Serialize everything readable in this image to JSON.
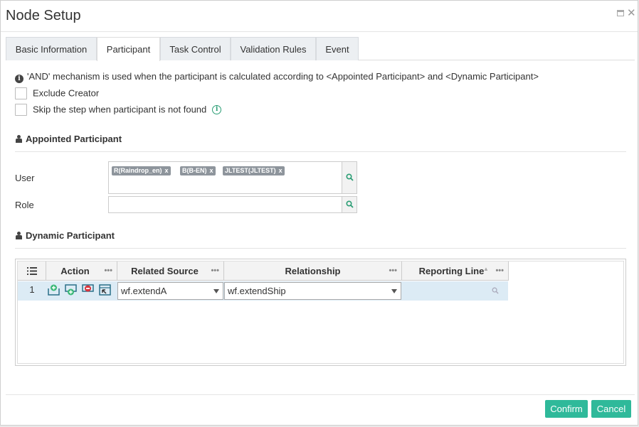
{
  "dialog": {
    "title": "Node Setup",
    "maximize_icon": "maximize-icon",
    "close_icon": "close-icon",
    "close_glyph": "✕"
  },
  "tabs": [
    {
      "label": "Basic Information",
      "active": false
    },
    {
      "label": "Participant",
      "active": true
    },
    {
      "label": "Task Control",
      "active": false
    },
    {
      "label": "Validation Rules",
      "active": false
    },
    {
      "label": "Event",
      "active": false
    }
  ],
  "info": {
    "icon": "info-icon",
    "icon_glyph": "i",
    "text": "'AND' mechanism is used when the participant is calculated according to <Appointed Participant> and <Dynamic Participant>"
  },
  "options": {
    "exclude_creator": {
      "label": "Exclude Creator",
      "checked": false
    },
    "skip_step": {
      "label": "Skip the step when participant is not found",
      "checked": false,
      "help_icon": "help-icon",
      "help_glyph": "i"
    }
  },
  "appointed": {
    "heading": "Appointed Participant",
    "user_label": "User",
    "users": [
      {
        "text": "R(Raindrop_en)",
        "remove": "x"
      },
      {
        "text": "B(B-EN)",
        "remove": "x"
      },
      {
        "text": "JLTEST(JLTEST)",
        "remove": "x"
      }
    ],
    "role_label": "Role",
    "role_value": ""
  },
  "dynamic": {
    "heading": "Dynamic Participant",
    "columns": {
      "action": "Action",
      "related_source": "Related Source",
      "relationship": "Relationship",
      "reporting_line": "Reporting Line",
      "dots": "•••"
    },
    "rows": [
      {
        "num": "1",
        "actions": [
          "add-above-icon",
          "add-below-icon",
          "delete-row-icon",
          "edit-row-icon"
        ],
        "related_source": "wf.extendA",
        "relationship": "wf.extendShip",
        "reporting_line": ""
      }
    ]
  },
  "footer": {
    "confirm_label": "Confirm",
    "cancel_label": "Cancel"
  },
  "colors": {
    "accent": "#2fb99a",
    "selected_row": "#dcebf5",
    "chip": "#8e959c"
  }
}
